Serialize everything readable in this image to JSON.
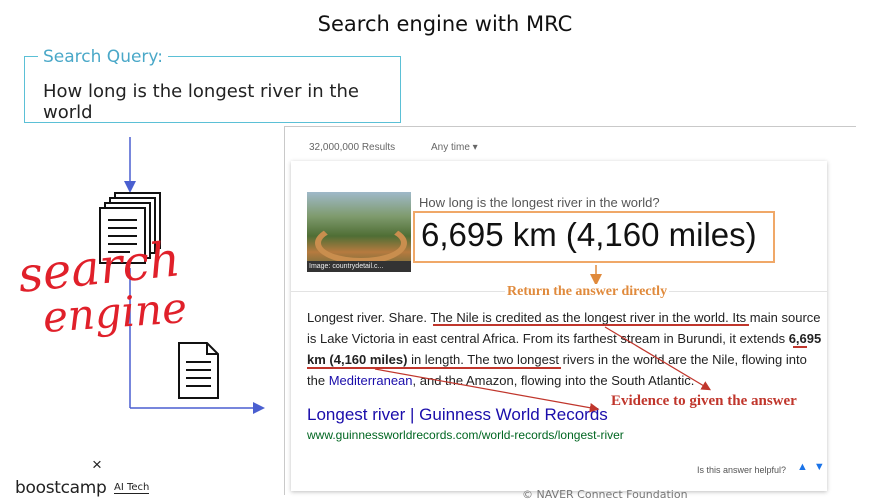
{
  "slide": {
    "title": "Search engine with MRC"
  },
  "query_box": {
    "legend": "Search Query:",
    "text": "How long is the longest river in the world"
  },
  "diagram": {
    "handwriting": [
      "search",
      "engine"
    ],
    "colors": {
      "arrow": "#4a5fd0",
      "handwriting": "#e0202a"
    }
  },
  "results": {
    "count": "32,000,000 Results",
    "filter": "Any time ▾",
    "card": {
      "image_caption": "Image: countrydetail.c...",
      "question": "How long is the longest river in the world?",
      "answer": "6,695 km (4,160 miles)",
      "snippet": {
        "p1": "Longest river. Share. ",
        "p2": "The Nile is credited as the longest river in the world.",
        "p3": " Its main source is Lake Victoria in east central Africa. From its farthest stream in Burundi, it extends ",
        "p4": "6,695 km (4,160 miles)",
        "p5": " in length. The two longest rivers in the world are the Nile, flowing into the ",
        "link": "Mediterranean",
        "p6": ", and the Amazon, flowing into the South Atlantic."
      },
      "link_title": "Longest river | Guinness World Records",
      "link_url": "www.guinnessworldrecords.com/world-records/longest-river",
      "helpful": "Is this answer helpful?"
    },
    "annotations": {
      "direct": "Return the answer directly",
      "evidence": "Evidence to given the answer"
    }
  },
  "brand": {
    "x": "×",
    "name": "boostcamp",
    "sub": "AI Tech"
  },
  "footer": "© NAVER Connect Foundation"
}
